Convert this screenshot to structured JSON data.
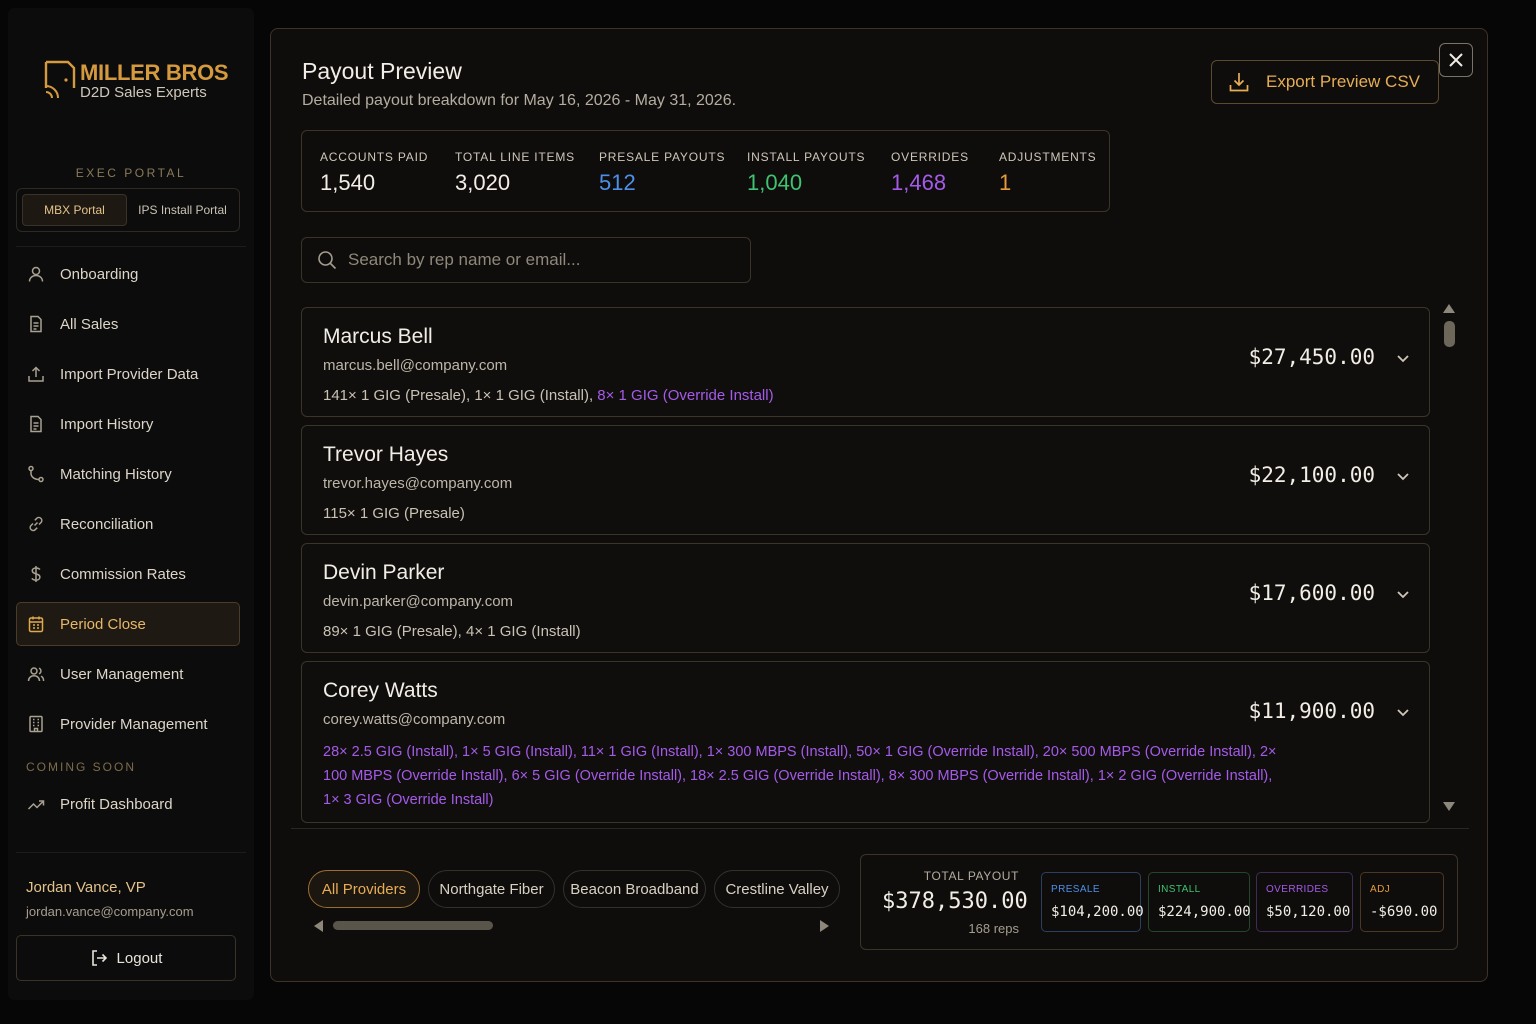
{
  "brand": {
    "title": "MILLER BROS",
    "subtitle": "D2D Sales Experts"
  },
  "sidebar": {
    "section_label": "EXEC PORTAL",
    "portals": [
      {
        "label": "MBX Portal",
        "active": true
      },
      {
        "label": "IPS Install Portal",
        "active": false
      }
    ],
    "items": [
      {
        "label": "Onboarding",
        "icon": "user-icon"
      },
      {
        "label": "All Sales",
        "icon": "document-icon"
      },
      {
        "label": "Import Provider Data",
        "icon": "upload-icon"
      },
      {
        "label": "Import History",
        "icon": "document-icon"
      },
      {
        "label": "Matching History",
        "icon": "branch-icon"
      },
      {
        "label": "Reconciliation",
        "icon": "link-icon"
      },
      {
        "label": "Commission Rates",
        "icon": "dollar-icon"
      },
      {
        "label": "Period Close",
        "icon": "calendar-icon",
        "active": true
      },
      {
        "label": "User Management",
        "icon": "users-icon"
      },
      {
        "label": "Provider Management",
        "icon": "building-icon"
      }
    ],
    "coming_soon_label": "COMING SOON",
    "coming_soon_items": [
      {
        "label": "Profit Dashboard",
        "icon": "trend-icon"
      }
    ],
    "user": {
      "name": "Jordan Vance, VP",
      "email": "jordan.vance@company.com"
    },
    "logout_label": "Logout"
  },
  "modal": {
    "title": "Payout Preview",
    "subtitle": "Detailed payout breakdown for May 16, 2026 - May 31, 2026.",
    "export_label": "Export Preview CSV",
    "stats": [
      {
        "label": "ACCOUNTS PAID",
        "value": "1,540",
        "color": "#f2eee6"
      },
      {
        "label": "TOTAL LINE ITEMS",
        "value": "3,020",
        "color": "#f2eee6"
      },
      {
        "label": "PRESALE PAYOUTS",
        "value": "512",
        "color": "#4e8fe8"
      },
      {
        "label": "INSTALL PAYOUTS",
        "value": "1,040",
        "color": "#3fc271"
      },
      {
        "label": "OVERRIDES",
        "value": "1,468",
        "color": "#a55be8"
      },
      {
        "label": "ADJUSTMENTS",
        "value": "1",
        "color": "#e69a3a"
      }
    ],
    "search_placeholder": "Search by rep name or email...",
    "reps": [
      {
        "name": "Marcus Bell",
        "email": "marcus.bell@company.com",
        "amount": "$27,450.00",
        "items": "141× 1 GIG (Presale), 1× 1 GIG (Install), ",
        "overrides": "8× 1 GIG (Override Install)"
      },
      {
        "name": "Trevor Hayes",
        "email": "trevor.hayes@company.com",
        "amount": "$22,100.00",
        "items": "115× 1 GIG (Presale)",
        "overrides": ""
      },
      {
        "name": "Devin Parker",
        "email": "devin.parker@company.com",
        "amount": "$17,600.00",
        "items": "89× 1 GIG (Presale), 4× 1 GIG (Install)",
        "overrides": ""
      },
      {
        "name": "Corey Watts",
        "email": "corey.watts@company.com",
        "amount": "$11,900.00",
        "items": "",
        "overrides": "28× 2.5 GIG (Install), 1× 5 GIG (Install), 11× 1 GIG (Install), 1× 300 MBPS (Install), 50× 1 GIG (Override Install), 20× 500 MBPS (Override Install), 2× 100 MBPS (Override Install), 6× 5 GIG (Override Install), 18× 2.5 GIG (Override Install), 8× 300 MBPS (Override Install), 1× 2 GIG (Override Install), 1× 3 GIG (Override Install)"
      }
    ],
    "providers": [
      {
        "label": "All Providers",
        "active": true
      },
      {
        "label": "Northgate Fiber",
        "active": false
      },
      {
        "label": "Beacon Broadband",
        "active": false
      },
      {
        "label": "Crestline Valley",
        "active": false
      }
    ],
    "totals": {
      "label": "TOTAL PAYOUT",
      "value": "$378,530.00",
      "reps": "168 reps",
      "breakdown": [
        {
          "label": "PRESALE",
          "value": "$104,200.00",
          "color": "#4e8fe8",
          "border": "#2b4060"
        },
        {
          "label": "INSTALL",
          "value": "$224,900.00",
          "color": "#3fc271",
          "border": "#24452f"
        },
        {
          "label": "OVERRIDES",
          "value": "$50,120.00",
          "color": "#a55be8",
          "border": "#3f2c55"
        },
        {
          "label": "ADJ",
          "value": "-$690.00",
          "color": "#e69a3a",
          "border": "#4c3822"
        }
      ]
    }
  }
}
